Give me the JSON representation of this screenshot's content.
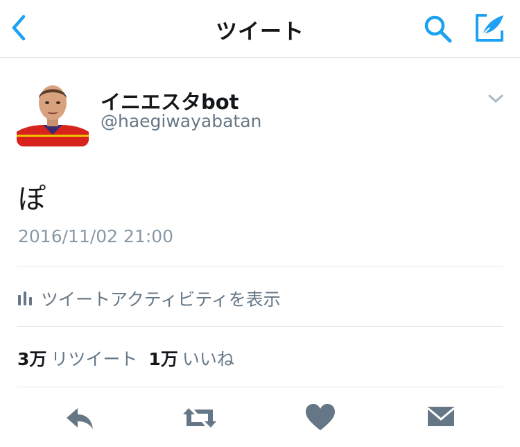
{
  "nav": {
    "title": "ツイート",
    "back_icon": "back-chevron-icon",
    "search_icon": "search-icon",
    "compose_icon": "compose-tweet-icon",
    "accent_color": "#1da1f2"
  },
  "tweet": {
    "author": {
      "display_name": "イニエスタbot",
      "handle": "@haegiwayabatan"
    },
    "text": "ぽ",
    "timestamp": "2016/11/02 21:00",
    "activity_label": "ツイートアクティビティを表示",
    "stats": {
      "retweets_count": "3万",
      "retweets_label": "リツイート",
      "likes_count": "1万",
      "likes_label": "いいね"
    }
  },
  "actions": [
    "reply-icon",
    "retweet-icon",
    "like-icon",
    "direct-message-icon"
  ],
  "colors": {
    "text_primary": "#14171a",
    "text_secondary": "#657786",
    "timestamp": "#8899a6",
    "icon_gray": "#657786",
    "divider": "#e1e8ed"
  }
}
